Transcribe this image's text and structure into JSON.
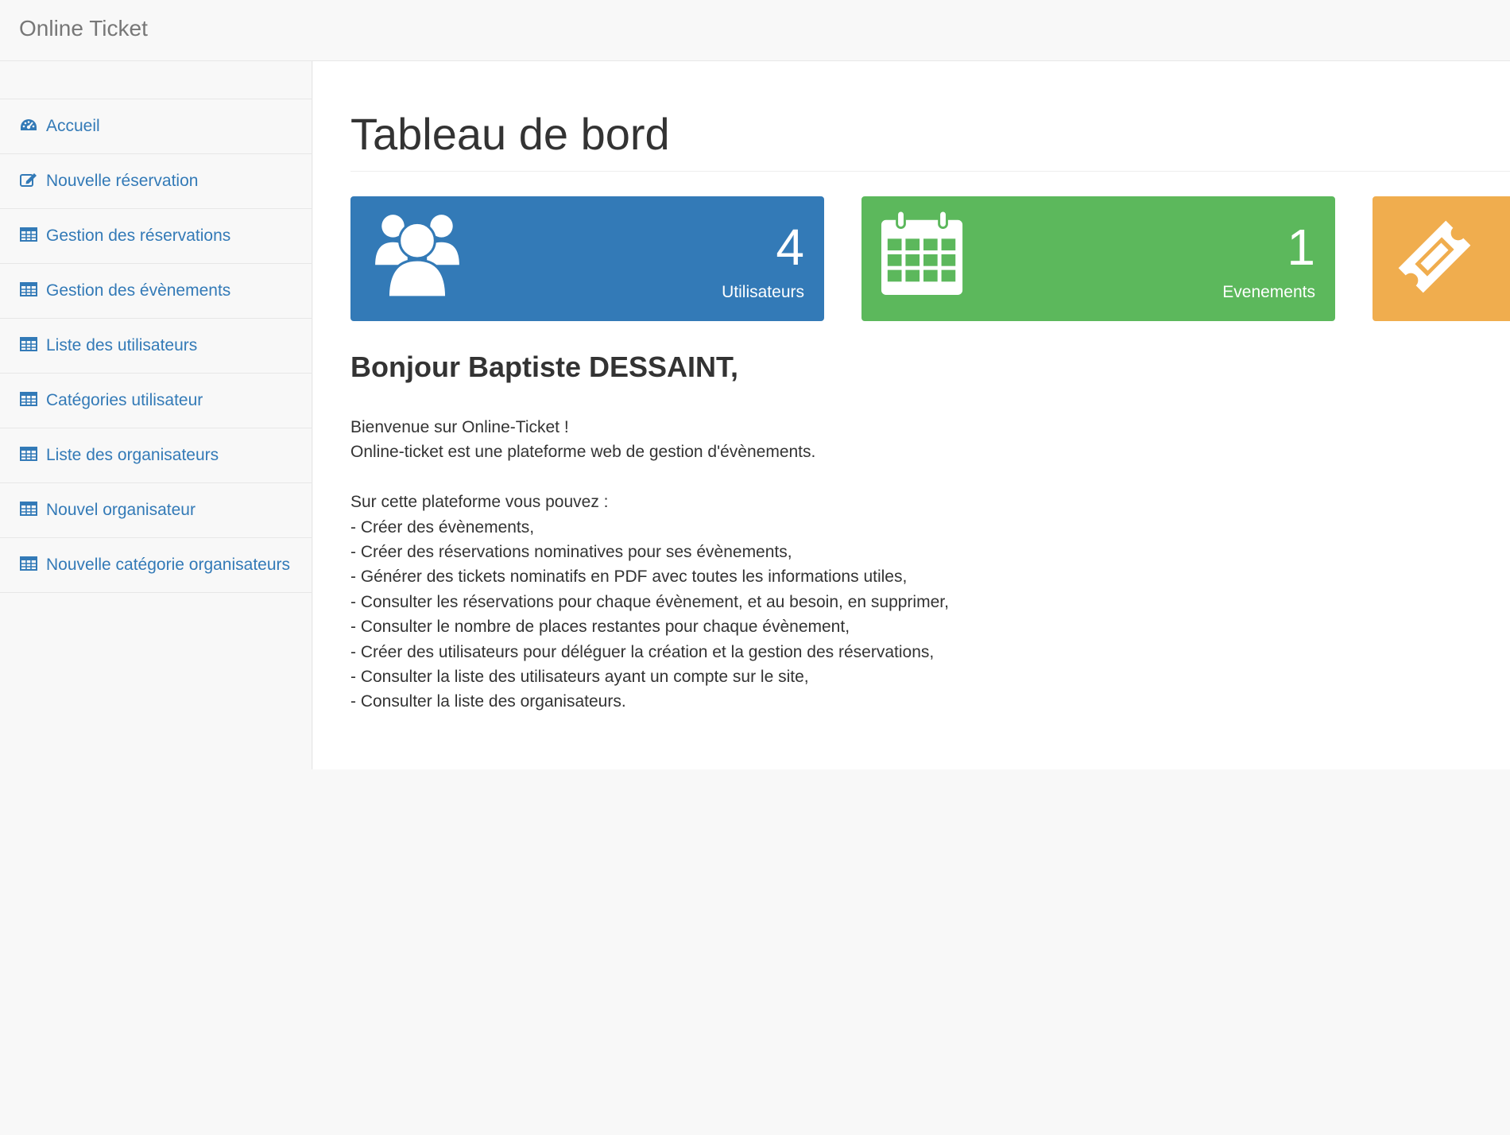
{
  "navbar": {
    "brand": "Online Ticket"
  },
  "sidebar": {
    "items": [
      {
        "label": "Accueil",
        "icon": "dashboard-icon"
      },
      {
        "label": "Nouvelle réservation",
        "icon": "edit-icon"
      },
      {
        "label": "Gestion des réservations",
        "icon": "table-icon"
      },
      {
        "label": "Gestion des évènements",
        "icon": "table-icon"
      },
      {
        "label": "Liste des utilisateurs",
        "icon": "table-icon"
      },
      {
        "label": "Catégories utilisateur",
        "icon": "table-icon"
      },
      {
        "label": "Liste des organisateurs",
        "icon": "table-icon"
      },
      {
        "label": "Nouvel organisateur",
        "icon": "table-icon"
      },
      {
        "label": "Nouvelle catégorie organisateurs",
        "icon": "table-icon"
      }
    ]
  },
  "main": {
    "title": "Tableau de bord",
    "panels": [
      {
        "count": "4",
        "label": "Utilisateurs",
        "icon": "users-icon",
        "color": "#337ab7"
      },
      {
        "count": "1",
        "label": "Evenements",
        "icon": "calendar-icon",
        "color": "#5cb85c"
      },
      {
        "icon": "ticket-icon",
        "color": "#f0ad4e"
      }
    ],
    "greeting": "Bonjour Baptiste DESSAINT,",
    "intro": [
      "Bienvenue sur Online-Ticket !",
      "Online-ticket est une plateforme web de gestion d'évènements."
    ],
    "features_heading": "Sur cette plateforme vous pouvez :",
    "features": [
      "- Créer des évènements,",
      "- Créer des réservations nominatives pour ses évènements,",
      "- Générer des tickets nominatifs en PDF avec toutes les informations utiles,",
      "- Consulter les réservations pour chaque évènement, et au besoin, en supprimer,",
      "- Consulter le nombre de places restantes pour chaque évènement,",
      "- Créer des utilisateurs pour déléguer la création et la gestion des réservations,",
      "- Consulter la liste des utilisateurs ayant un compte sur le site,",
      "- Consulter la liste des organisateurs."
    ]
  }
}
